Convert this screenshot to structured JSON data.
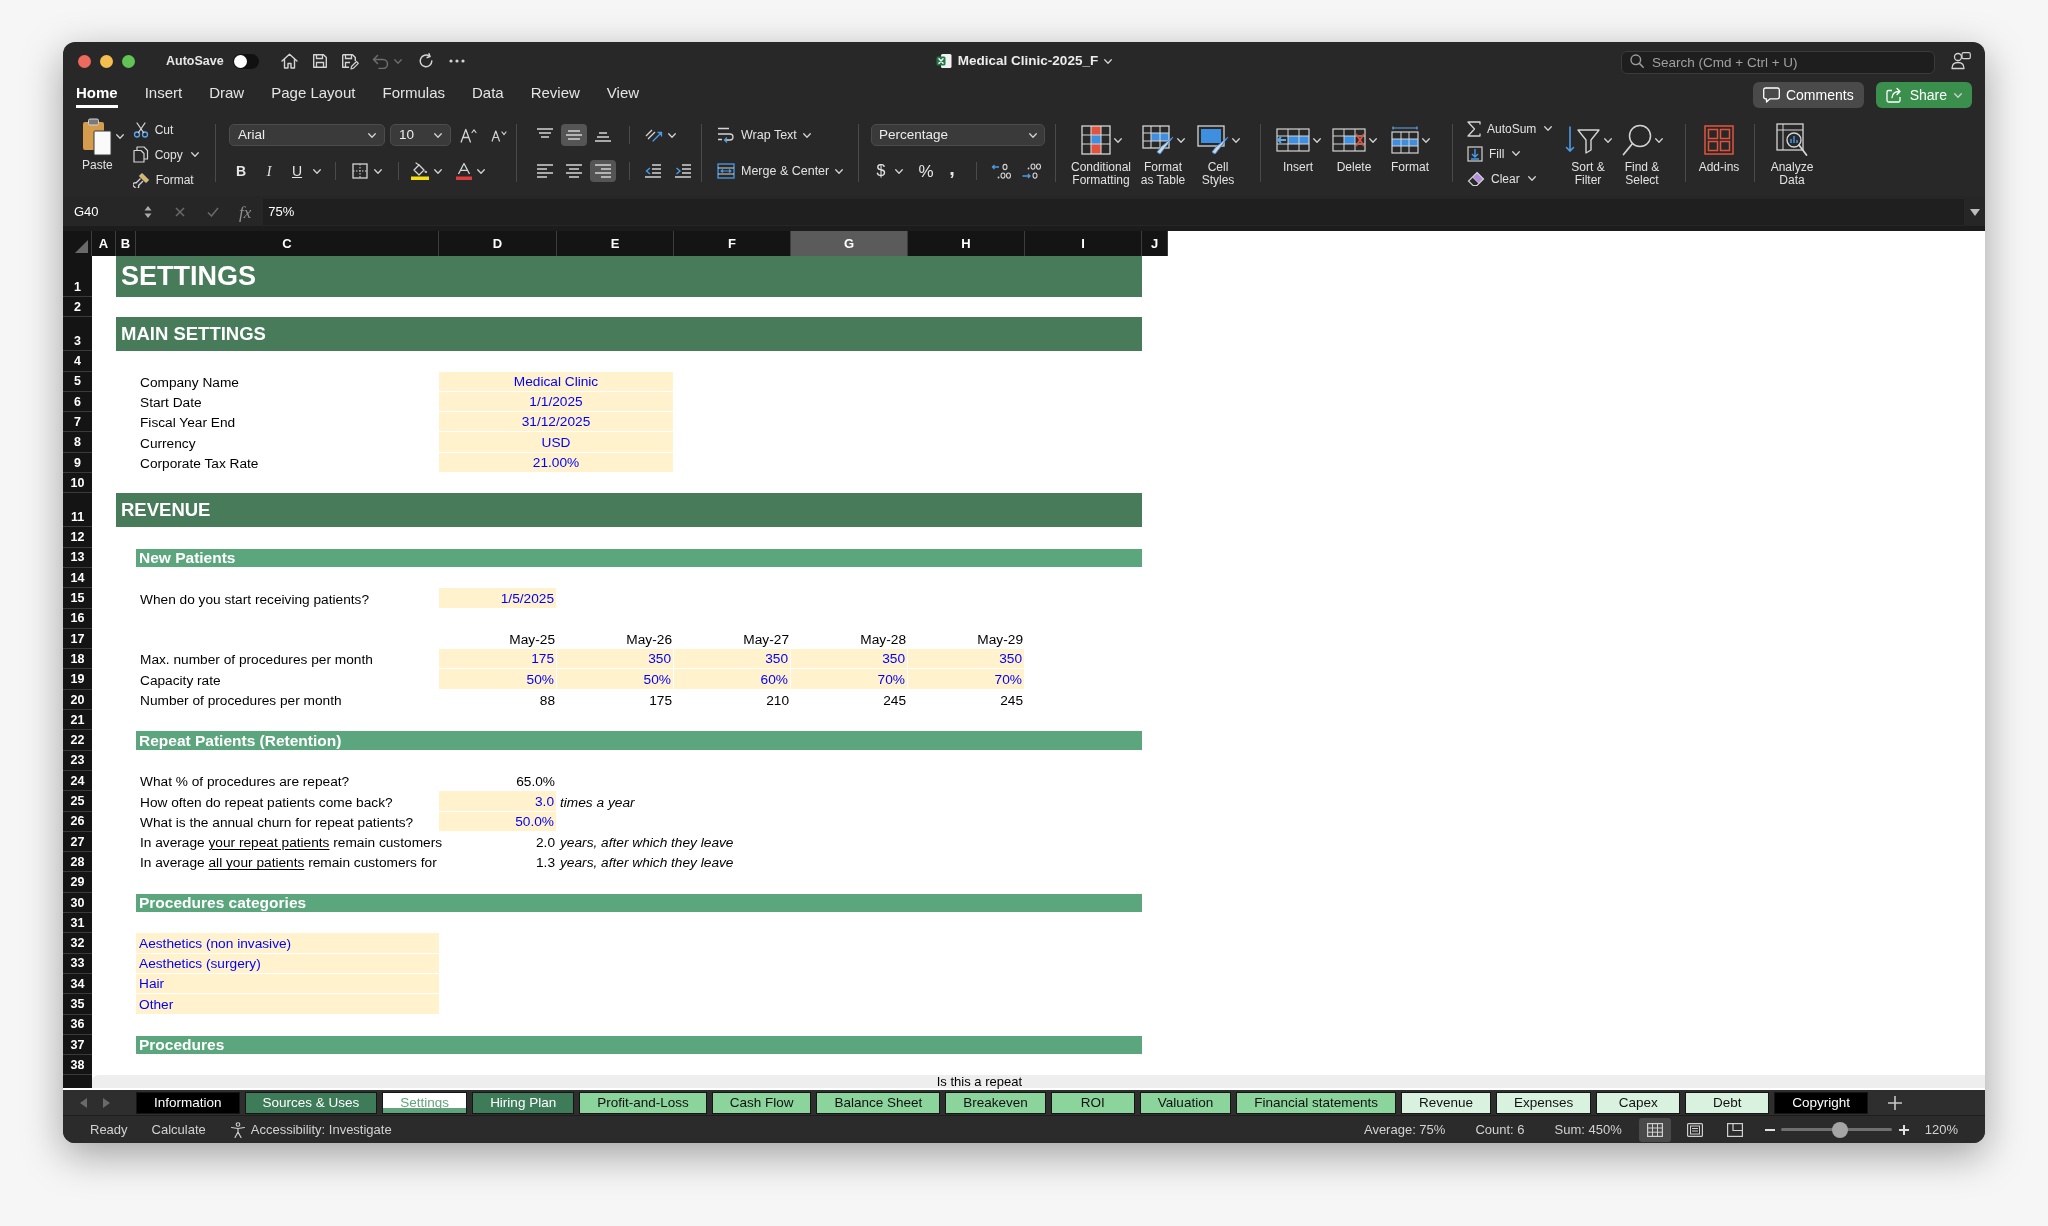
{
  "window": {
    "title": "Medical Clinic-2025_F",
    "autosave": {
      "label": "AutoSave",
      "on": false
    },
    "search_placeholder": "Search (Cmd + Ctrl + U)"
  },
  "ribbon_tabs": [
    {
      "label": "Home",
      "selected": true
    },
    {
      "label": "Insert",
      "selected": false
    },
    {
      "label": "Draw",
      "selected": false
    },
    {
      "label": "Page Layout",
      "selected": false
    },
    {
      "label": "Formulas",
      "selected": false
    },
    {
      "label": "Data",
      "selected": false
    },
    {
      "label": "Review",
      "selected": false
    },
    {
      "label": "View",
      "selected": false
    }
  ],
  "header_buttons": {
    "comments": "Comments",
    "share": "Share"
  },
  "ribbon": {
    "paste": "Paste",
    "clipboard": [
      {
        "kind": "cut",
        "label": "Cut"
      },
      {
        "kind": "copy",
        "label": "Copy"
      },
      {
        "kind": "format",
        "label": "Format"
      }
    ],
    "font_name": "Arial",
    "font_size": "10",
    "text_styles": [
      {
        "kind": "bold",
        "label": "B"
      },
      {
        "kind": "italic",
        "label": "I"
      },
      {
        "kind": "underline",
        "label": "U"
      }
    ],
    "vertical_align": [
      {
        "kind": "top",
        "selected": false
      },
      {
        "kind": "middle",
        "selected": true
      },
      {
        "kind": "bottom",
        "selected": false
      }
    ],
    "horizontal_align": [
      {
        "kind": "left",
        "selected": false
      },
      {
        "kind": "center",
        "selected": false
      },
      {
        "kind": "right",
        "selected": true
      }
    ],
    "wrap_text": "Wrap Text",
    "merge_center": "Merge & Center",
    "number_format": "Percentage",
    "number_symbols": [
      {
        "kind": "currency",
        "label": "$"
      },
      {
        "kind": "percent",
        "label": "%"
      },
      {
        "kind": "comma",
        "label": ","
      }
    ],
    "style_buttons": [
      {
        "kind": "conditional",
        "label": "Conditional\nFormatting"
      },
      {
        "kind": "table",
        "label": "Format\nas Table"
      },
      {
        "kind": "styles",
        "label": "Cell\nStyles"
      }
    ],
    "cell_buttons": [
      {
        "kind": "insert",
        "label": "Insert"
      },
      {
        "kind": "delete",
        "label": "Delete"
      },
      {
        "kind": "format",
        "label": "Format"
      }
    ],
    "editing": [
      {
        "kind": "autosum",
        "label": "AutoSum"
      },
      {
        "kind": "fill",
        "label": "Fill"
      },
      {
        "kind": "clear",
        "label": "Clear"
      }
    ],
    "editing_large": [
      {
        "kind": "sort",
        "label": "Sort &\nFilter"
      },
      {
        "kind": "find",
        "label": "Find &\nSelect"
      }
    ],
    "addins": "Add-ins",
    "analyze": "Analyze\nData"
  },
  "formula_bar": {
    "cell_ref": "G40",
    "fx": "fx",
    "value": "75%"
  },
  "columns": [
    {
      "label": "A",
      "selected": false
    },
    {
      "label": "B",
      "selected": false
    },
    {
      "label": "C",
      "selected": false
    },
    {
      "label": "D",
      "selected": false
    },
    {
      "label": "E",
      "selected": false
    },
    {
      "label": "F",
      "selected": false
    },
    {
      "label": "G",
      "selected": true
    },
    {
      "label": "H",
      "selected": false
    },
    {
      "label": "I",
      "selected": false
    },
    {
      "label": "J",
      "selected": false
    }
  ],
  "rows": [
    {
      "number": "1",
      "kind": "title",
      "text": "SETTINGS"
    },
    {
      "number": "2",
      "kind": "blank"
    },
    {
      "number": "3",
      "kind": "section",
      "text": "MAIN SETTINGS"
    },
    {
      "number": "4",
      "kind": "blank"
    },
    {
      "number": "5",
      "kind": "setting",
      "label": "Company Name",
      "value": "Medical Clinic"
    },
    {
      "number": "6",
      "kind": "setting",
      "label": "Start Date",
      "value": "1/1/2025"
    },
    {
      "number": "7",
      "kind": "setting",
      "label": "Fiscal Year End",
      "value": "31/12/2025"
    },
    {
      "number": "8",
      "kind": "setting",
      "label": "Currency",
      "value": "USD"
    },
    {
      "number": "9",
      "kind": "setting",
      "label": "Corporate Tax Rate",
      "value": "21.00%"
    },
    {
      "number": "10",
      "kind": "blank"
    },
    {
      "number": "11",
      "kind": "section",
      "text": "REVENUE"
    },
    {
      "number": "12",
      "kind": "blank"
    },
    {
      "number": "13",
      "kind": "subsection",
      "text": "New Patients"
    },
    {
      "number": "14",
      "kind": "blank"
    },
    {
      "number": "15",
      "kind": "input_row",
      "label": "When do you start receiving patients?",
      "values": [
        "1/5/2025"
      ]
    },
    {
      "number": "16",
      "kind": "blank"
    },
    {
      "number": "17",
      "kind": "header_row",
      "values": [
        "May-25",
        "May-26",
        "May-27",
        "May-28",
        "May-29"
      ]
    },
    {
      "number": "18",
      "kind": "input_row",
      "label": "Max. number of procedures per month",
      "values": [
        "175",
        "350",
        "350",
        "350",
        "350"
      ]
    },
    {
      "number": "19",
      "kind": "input_row",
      "label": "Capacity rate",
      "values": [
        "50%",
        "50%",
        "60%",
        "70%",
        "70%"
      ]
    },
    {
      "number": "20",
      "kind": "calc_row",
      "label": "Number of procedures per month",
      "values": [
        "88",
        "175",
        "210",
        "245",
        "245"
      ]
    },
    {
      "number": "21",
      "kind": "blank"
    },
    {
      "number": "22",
      "kind": "subsection",
      "text": "Repeat Patients (Retention)"
    },
    {
      "number": "23",
      "kind": "blank"
    },
    {
      "number": "24",
      "kind": "calc_row",
      "label": "What % of procedures are repeat?",
      "values": [
        "65.0%"
      ]
    },
    {
      "number": "25",
      "kind": "input_row",
      "label": "How often do repeat patients come back?",
      "values": [
        "3.0"
      ],
      "note": "times a year"
    },
    {
      "number": "26",
      "kind": "input_row",
      "label": "What is the annual churn for repeat patients?",
      "values": [
        "50.0%"
      ]
    },
    {
      "number": "27",
      "kind": "calc_row",
      "label_parts": [
        {
          "text": "In average ",
          "underlined": false
        },
        {
          "text": "your repeat patients",
          "underlined": true
        },
        {
          "text": " remain customers",
          "underlined": false
        }
      ],
      "values": [
        "2.0"
      ],
      "note": "years, after which they leave"
    },
    {
      "number": "28",
      "kind": "calc_row",
      "label_parts": [
        {
          "text": "In average ",
          "underlined": false
        },
        {
          "text": "all your patients",
          "underlined": true
        },
        {
          "text": " remain customers for",
          "underlined": false
        }
      ],
      "values": [
        "1.3"
      ],
      "note": "years, after which they leave"
    },
    {
      "number": "29",
      "kind": "blank"
    },
    {
      "number": "30",
      "kind": "subsection",
      "text": "Procedures categories"
    },
    {
      "number": "31",
      "kind": "blank"
    },
    {
      "number": "32",
      "kind": "category",
      "label": "Aesthetics (non invasive)"
    },
    {
      "number": "33",
      "kind": "category",
      "label": "Aesthetics (surgery)"
    },
    {
      "number": "34",
      "kind": "category",
      "label": "Hair"
    },
    {
      "number": "35",
      "kind": "category",
      "label": "Other"
    },
    {
      "number": "36",
      "kind": "blank"
    },
    {
      "number": "37",
      "kind": "subsection",
      "text": "Procedures"
    },
    {
      "number": "38",
      "kind": "blank"
    }
  ],
  "partial_row": {
    "text": "Is this a repeat"
  },
  "sheet_tabs": [
    {
      "label": "Information",
      "color": "#000000",
      "selected": false
    },
    {
      "label": "Sources & Uses",
      "color": "#3e7b58",
      "selected": false
    },
    {
      "label": "Settings",
      "color": "#5fa47b",
      "selected": true
    },
    {
      "label": "Hiring Plan",
      "color": "#3e7b58",
      "selected": false
    },
    {
      "label": "Profit-and-Loss",
      "color": "#8bd49c",
      "selected": false
    },
    {
      "label": "Cash Flow",
      "color": "#8bd49c",
      "selected": false
    },
    {
      "label": "Balance Sheet",
      "color": "#8bd49c",
      "selected": false
    },
    {
      "label": "Breakeven",
      "color": "#8bd49c",
      "selected": false
    },
    {
      "label": "ROI",
      "color": "#8bd49c",
      "selected": false
    },
    {
      "label": "Valuation",
      "color": "#8bd49c",
      "selected": false
    },
    {
      "label": "Financial statements",
      "color": "#8bd49c",
      "selected": false
    },
    {
      "label": "Revenue",
      "color": "#d9f2e0",
      "selected": false
    },
    {
      "label": "Expenses",
      "color": "#d9f2e0",
      "selected": false
    },
    {
      "label": "Capex",
      "color": "#d9f2e0",
      "selected": false
    },
    {
      "label": "Debt",
      "color": "#d9f2e0",
      "selected": false
    },
    {
      "label": "Copyright",
      "color": "#000000",
      "selected": false
    }
  ],
  "status_bar": {
    "left": [
      {
        "kind": "text",
        "label": "Ready"
      },
      {
        "kind": "text",
        "label": "Calculate"
      },
      {
        "kind": "accessibility",
        "label": "Accessibility: Investigate"
      }
    ],
    "stats": [
      "Average: 75%",
      "Count: 6",
      "Sum: 450%"
    ],
    "views": [
      {
        "kind": "normal",
        "selected": true
      },
      {
        "kind": "page_layout",
        "selected": false
      },
      {
        "kind": "page_break",
        "selected": false
      }
    ],
    "zoom": {
      "level": 0.53,
      "label": "120%"
    }
  }
}
